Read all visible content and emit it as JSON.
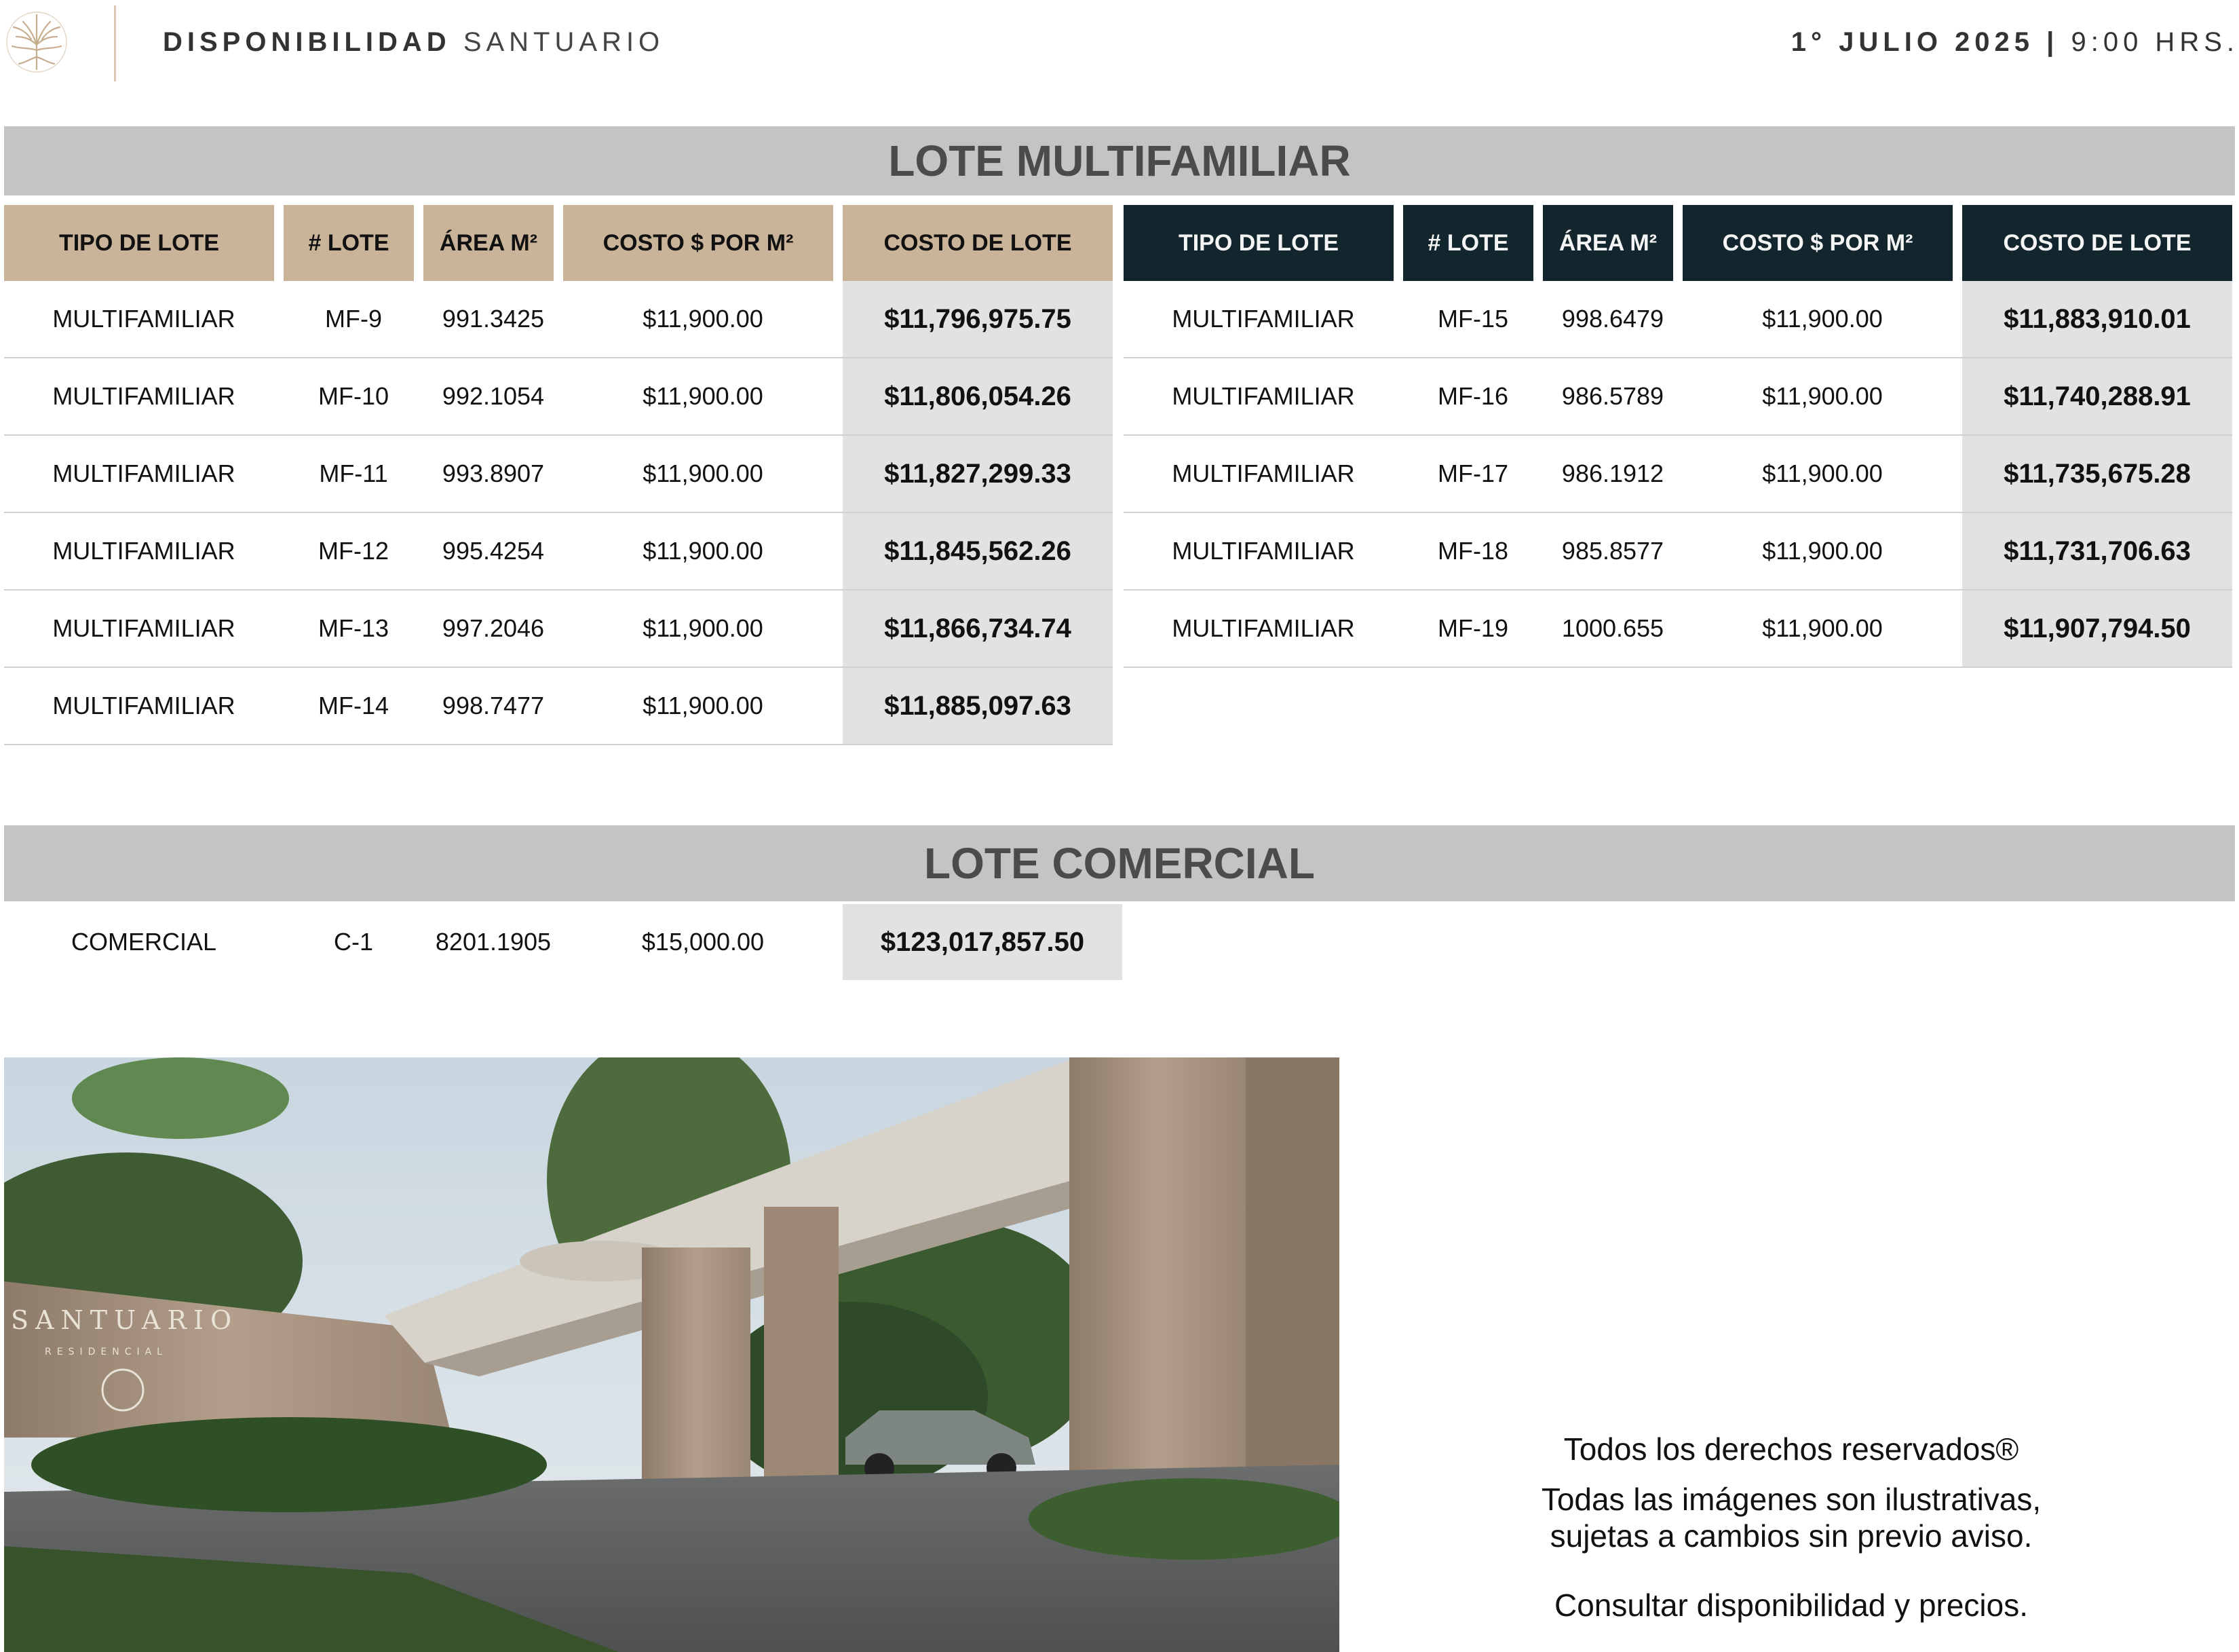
{
  "header": {
    "title_bold": "DISPONIBILIDAD",
    "title_rest": "SANTUARIO",
    "date_bold": "1° JULIO 2025",
    "date_sep": " | ",
    "date_time": "9:00 HRS."
  },
  "multifamiliar": {
    "title": "LOTE MULTIFAMILIAR",
    "headers": [
      "TIPO DE LOTE",
      "# LOTE",
      "ÁREA M²",
      "COSTO $ POR M²",
      "COSTO DE LOTE"
    ],
    "left_rows": [
      [
        "MULTIFAMILIAR",
        "MF-9",
        "991.3425",
        "$11,900.00",
        "$11,796,975.75"
      ],
      [
        "MULTIFAMILIAR",
        "MF-10",
        "992.1054",
        "$11,900.00",
        "$11,806,054.26"
      ],
      [
        "MULTIFAMILIAR",
        "MF-11",
        "993.8907",
        "$11,900.00",
        "$11,827,299.33"
      ],
      [
        "MULTIFAMILIAR",
        "MF-12",
        "995.4254",
        "$11,900.00",
        "$11,845,562.26"
      ],
      [
        "MULTIFAMILIAR",
        "MF-13",
        "997.2046",
        "$11,900.00",
        "$11,866,734.74"
      ],
      [
        "MULTIFAMILIAR",
        "MF-14",
        "998.7477",
        "$11,900.00",
        "$11,885,097.63"
      ]
    ],
    "right_rows": [
      [
        "MULTIFAMILIAR",
        "MF-15",
        "998.6479",
        "$11,900.00",
        "$11,883,910.01"
      ],
      [
        "MULTIFAMILIAR",
        "MF-16",
        "986.5789",
        "$11,900.00",
        "$11,740,288.91"
      ],
      [
        "MULTIFAMILIAR",
        "MF-17",
        "986.1912",
        "$11,900.00",
        "$11,735,675.28"
      ],
      [
        "MULTIFAMILIAR",
        "MF-18",
        "985.8577",
        "$11,900.00",
        "$11,731,706.63"
      ],
      [
        "MULTIFAMILIAR",
        "MF-19",
        "1000.655",
        "$11,900.00",
        "$11,907,794.50"
      ]
    ]
  },
  "comercial": {
    "title": "LOTE COMERCIAL",
    "rows": [
      [
        "COMERCIAL",
        "C-1",
        "8201.1905",
        "$15,000.00",
        "$123,017,857.50"
      ]
    ]
  },
  "photo": {
    "sign_name": "SANTUARIO",
    "sign_sub": "RESIDENCIAL"
  },
  "notes": {
    "line1": "Todos los derechos reservados®",
    "line2": "Todas las imágenes son ilustrativas,",
    "line3": "sujetas a cambios sin previo aviso.",
    "line4": "Consultar disponibilidad y precios."
  },
  "colors": {
    "left_header_bg": "#c9b49a",
    "right_header_bg": "#13262e",
    "section_bar_bg": "#c4c4c4",
    "cost_cell_bg": "#e2e2e2"
  }
}
